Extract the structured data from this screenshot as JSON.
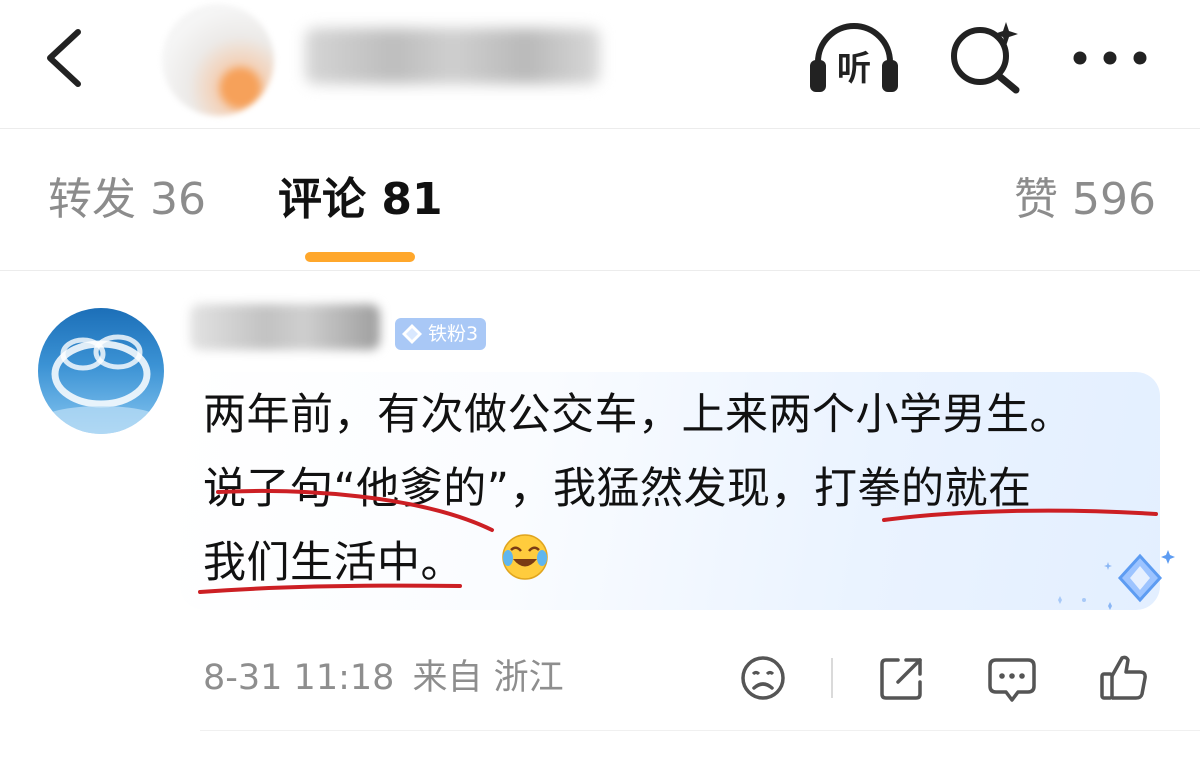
{
  "header": {
    "back_icon": "chevron-left-icon",
    "listen_label": "听",
    "search_icon": "search-sparkle-icon",
    "more_icon": "ellipsis-icon"
  },
  "tabs": [
    {
      "name": "转发",
      "count": "36"
    },
    {
      "name": "评论",
      "count": "81"
    },
    {
      "name": "赞",
      "count": "596"
    }
  ],
  "active_tab_index": 1,
  "colors": {
    "accent": "#ffa72b",
    "text_primary": "#111111",
    "text_secondary": "#8c8c8c",
    "badge_bg": "#a9c8f6",
    "underline_red": "#cc1f24"
  },
  "comment": {
    "badge": "铁粉3",
    "lines": [
      "两年前，有次做公交车，上来两个小学男生。",
      "说了句“他爹的”，我猛然发现，打拳的就在",
      "我们生活中。"
    ],
    "emoji": "laughing-crying-emoji",
    "time": "8-31 11:18",
    "location": "来自 浙江"
  },
  "actions": {
    "sad_icon": "sad-face-icon",
    "share_icon": "share-icon",
    "comment_icon": "comment-icon",
    "like_icon": "thumbs-up-icon"
  }
}
